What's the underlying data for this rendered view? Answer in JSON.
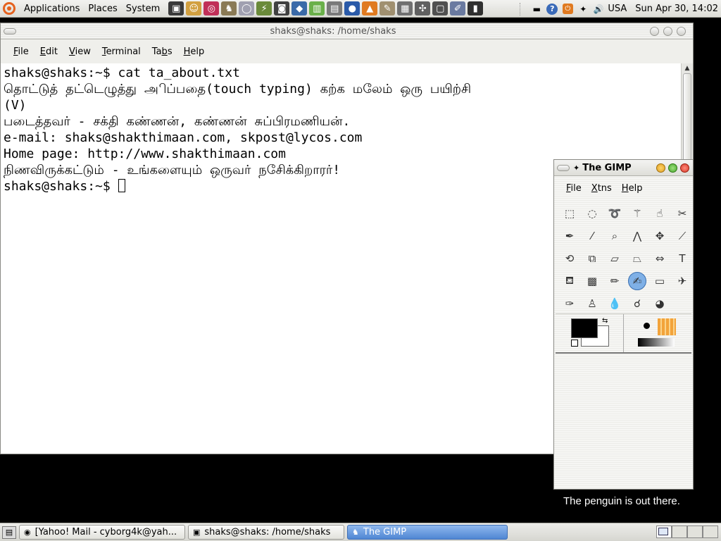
{
  "top_panel": {
    "menus": [
      "Applications",
      "Places",
      "System"
    ],
    "launchers": [
      {
        "icon": "terminal-launcher-icon",
        "glyph": "▣",
        "color": "#3a3a3a"
      },
      {
        "icon": "gaim-icon",
        "glyph": "☺",
        "color": "#d2a040"
      },
      {
        "icon": "cd-player-icon",
        "glyph": "◎",
        "color": "#c03058"
      },
      {
        "icon": "gimp-launcher-icon",
        "glyph": "♞",
        "color": "#8a7a55"
      },
      {
        "icon": "disc-icon",
        "glyph": "◯",
        "color": "#a0a0b0"
      },
      {
        "icon": "wifi-tool-icon",
        "glyph": "⚡",
        "color": "#6a8a3a"
      },
      {
        "icon": "photo-icon",
        "glyph": "◙",
        "color": "#404040"
      },
      {
        "icon": "fish-icon",
        "glyph": "◆",
        "color": "#3a6aa8"
      },
      {
        "icon": "equalizer-icon",
        "glyph": "▥",
        "color": "#6ab04a"
      },
      {
        "icon": "book-icon",
        "glyph": "▤",
        "color": "#7a7a7a"
      },
      {
        "icon": "globe-icon",
        "glyph": "●",
        "color": "#2a5aa8"
      },
      {
        "icon": "vlc-icon",
        "glyph": "▲",
        "color": "#e07a20"
      },
      {
        "icon": "notes-icon",
        "glyph": "✎",
        "color": "#a09070"
      },
      {
        "icon": "calculator-icon",
        "glyph": "▦",
        "color": "#707070"
      },
      {
        "icon": "network-icon",
        "glyph": "✣",
        "color": "#606060"
      },
      {
        "icon": "window-icon",
        "glyph": "▢",
        "color": "#505050"
      },
      {
        "icon": "editor-icon",
        "glyph": "✐",
        "color": "#6a7aa0"
      },
      {
        "icon": "console-icon",
        "glyph": "▮",
        "color": "#303030"
      }
    ],
    "tray": {
      "keyboard_label": "USA",
      "clock": "Sun Apr 30, 14:02"
    }
  },
  "terminal": {
    "title": "shaks@shaks: /home/shaks",
    "menus": [
      {
        "pre": "",
        "u": "F",
        "post": "ile"
      },
      {
        "pre": "",
        "u": "E",
        "post": "dit"
      },
      {
        "pre": "",
        "u": "V",
        "post": "iew"
      },
      {
        "pre": "",
        "u": "T",
        "post": "erminal"
      },
      {
        "pre": "Ta",
        "u": "b",
        "post": "s"
      },
      {
        "pre": "",
        "u": "H",
        "post": "elp"
      }
    ],
    "lines": [
      "shaks@shaks:~$ cat ta_about.txt",
      "தொட்டுத் தட்டெழுத்து அிப்பதை(touch typing) கற்க மலேம் ஒரு பயிற்சி",
      "(V)",
      "படைத்தவர் - சக்தி கண்ணன், கண்ணன் சுப்பிரமணியன்.",
      "e-mail: shaks@shakthimaan.com, skpost@lycos.com",
      "Home page: http://www.shakthimaan.com",
      "நிணவிருக்கட்டும் - உங்களையும் ஒருவர் நசேிக்கிறாரர்!"
    ],
    "prompt": "shaks@shaks:~$ "
  },
  "gimp": {
    "title": "The GIMP",
    "menus": [
      {
        "pre": "",
        "u": "F",
        "post": "ile"
      },
      {
        "pre": "",
        "u": "X",
        "post": "tns"
      },
      {
        "pre": "",
        "u": "H",
        "post": "elp"
      }
    ],
    "tools": [
      {
        "name": "rect-select-icon",
        "glyph": "⬚"
      },
      {
        "name": "ellipse-select-icon",
        "glyph": "◌"
      },
      {
        "name": "lasso-icon",
        "glyph": "➰"
      },
      {
        "name": "magic-wand-icon",
        "glyph": "⚚"
      },
      {
        "name": "select-by-color-icon",
        "glyph": "☝"
      },
      {
        "name": "scissors-icon",
        "glyph": "✂"
      },
      {
        "name": "paths-icon",
        "glyph": "✒"
      },
      {
        "name": "color-picker-icon",
        "glyph": "⁄"
      },
      {
        "name": "zoom-icon",
        "glyph": "⌕"
      },
      {
        "name": "measure-icon",
        "glyph": "⋀"
      },
      {
        "name": "move-icon",
        "glyph": "✥"
      },
      {
        "name": "crop-icon",
        "glyph": "⟋"
      },
      {
        "name": "rotate-icon",
        "glyph": "⟲"
      },
      {
        "name": "scale-icon",
        "glyph": "⧉"
      },
      {
        "name": "shear-icon",
        "glyph": "▱"
      },
      {
        "name": "perspective-icon",
        "glyph": "⏢"
      },
      {
        "name": "flip-icon",
        "glyph": "⇔"
      },
      {
        "name": "text-icon",
        "glyph": "T"
      },
      {
        "name": "bucket-fill-icon",
        "glyph": "⛾"
      },
      {
        "name": "blend-icon",
        "glyph": "▩"
      },
      {
        "name": "pencil-icon",
        "glyph": "✏"
      },
      {
        "name": "paintbrush-icon",
        "glyph": "✍"
      },
      {
        "name": "eraser-icon",
        "glyph": "▭"
      },
      {
        "name": "airbrush-icon",
        "glyph": "✈"
      },
      {
        "name": "ink-icon",
        "glyph": "✑"
      },
      {
        "name": "clone-icon",
        "glyph": "♙"
      },
      {
        "name": "blur-icon",
        "glyph": "💧"
      },
      {
        "name": "smudge-icon",
        "glyph": "☌"
      },
      {
        "name": "dodge-burn-icon",
        "glyph": "◕"
      }
    ],
    "active_tool_index": 21,
    "fg_color": "#000000",
    "bg_color": "#ffffff"
  },
  "desktop": {
    "caption": "The penguin is out there."
  },
  "taskbar": {
    "tasks": [
      {
        "label": "[Yahoo! Mail - cyborg4k@yah...",
        "icon": "firefox-icon",
        "glyph": "◉",
        "active": false
      },
      {
        "label": "shaks@shaks: /home/shaks",
        "icon": "terminal-task-icon",
        "glyph": "▣",
        "active": false
      },
      {
        "label": "The GIMP",
        "icon": "gimp-task-icon",
        "glyph": "♞",
        "active": true
      }
    ]
  }
}
